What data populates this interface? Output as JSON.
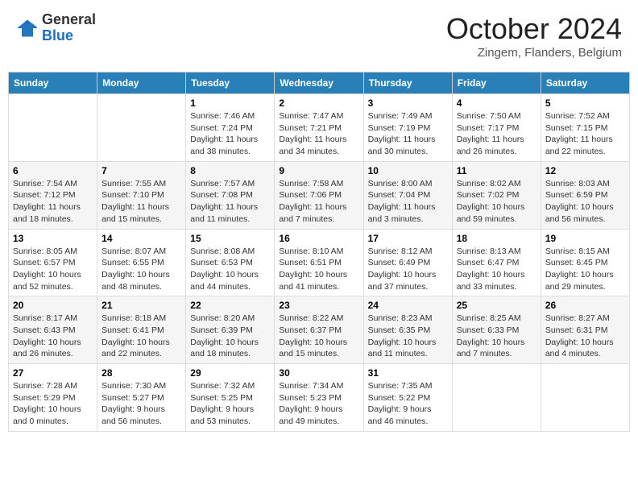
{
  "header": {
    "logo": {
      "general": "General",
      "blue": "Blue"
    },
    "title": "October 2024",
    "location": "Zingem, Flanders, Belgium"
  },
  "days_of_week": [
    "Sunday",
    "Monday",
    "Tuesday",
    "Wednesday",
    "Thursday",
    "Friday",
    "Saturday"
  ],
  "weeks": [
    [
      {
        "day": "",
        "info": ""
      },
      {
        "day": "",
        "info": ""
      },
      {
        "day": "1",
        "info": "Sunrise: 7:46 AM\nSunset: 7:24 PM\nDaylight: 11 hours and 38 minutes."
      },
      {
        "day": "2",
        "info": "Sunrise: 7:47 AM\nSunset: 7:21 PM\nDaylight: 11 hours and 34 minutes."
      },
      {
        "day": "3",
        "info": "Sunrise: 7:49 AM\nSunset: 7:19 PM\nDaylight: 11 hours and 30 minutes."
      },
      {
        "day": "4",
        "info": "Sunrise: 7:50 AM\nSunset: 7:17 PM\nDaylight: 11 hours and 26 minutes."
      },
      {
        "day": "5",
        "info": "Sunrise: 7:52 AM\nSunset: 7:15 PM\nDaylight: 11 hours and 22 minutes."
      }
    ],
    [
      {
        "day": "6",
        "info": "Sunrise: 7:54 AM\nSunset: 7:12 PM\nDaylight: 11 hours and 18 minutes."
      },
      {
        "day": "7",
        "info": "Sunrise: 7:55 AM\nSunset: 7:10 PM\nDaylight: 11 hours and 15 minutes."
      },
      {
        "day": "8",
        "info": "Sunrise: 7:57 AM\nSunset: 7:08 PM\nDaylight: 11 hours and 11 minutes."
      },
      {
        "day": "9",
        "info": "Sunrise: 7:58 AM\nSunset: 7:06 PM\nDaylight: 11 hours and 7 minutes."
      },
      {
        "day": "10",
        "info": "Sunrise: 8:00 AM\nSunset: 7:04 PM\nDaylight: 11 hours and 3 minutes."
      },
      {
        "day": "11",
        "info": "Sunrise: 8:02 AM\nSunset: 7:02 PM\nDaylight: 10 hours and 59 minutes."
      },
      {
        "day": "12",
        "info": "Sunrise: 8:03 AM\nSunset: 6:59 PM\nDaylight: 10 hours and 56 minutes."
      }
    ],
    [
      {
        "day": "13",
        "info": "Sunrise: 8:05 AM\nSunset: 6:57 PM\nDaylight: 10 hours and 52 minutes."
      },
      {
        "day": "14",
        "info": "Sunrise: 8:07 AM\nSunset: 6:55 PM\nDaylight: 10 hours and 48 minutes."
      },
      {
        "day": "15",
        "info": "Sunrise: 8:08 AM\nSunset: 6:53 PM\nDaylight: 10 hours and 44 minutes."
      },
      {
        "day": "16",
        "info": "Sunrise: 8:10 AM\nSunset: 6:51 PM\nDaylight: 10 hours and 41 minutes."
      },
      {
        "day": "17",
        "info": "Sunrise: 8:12 AM\nSunset: 6:49 PM\nDaylight: 10 hours and 37 minutes."
      },
      {
        "day": "18",
        "info": "Sunrise: 8:13 AM\nSunset: 6:47 PM\nDaylight: 10 hours and 33 minutes."
      },
      {
        "day": "19",
        "info": "Sunrise: 8:15 AM\nSunset: 6:45 PM\nDaylight: 10 hours and 29 minutes."
      }
    ],
    [
      {
        "day": "20",
        "info": "Sunrise: 8:17 AM\nSunset: 6:43 PM\nDaylight: 10 hours and 26 minutes."
      },
      {
        "day": "21",
        "info": "Sunrise: 8:18 AM\nSunset: 6:41 PM\nDaylight: 10 hours and 22 minutes."
      },
      {
        "day": "22",
        "info": "Sunrise: 8:20 AM\nSunset: 6:39 PM\nDaylight: 10 hours and 18 minutes."
      },
      {
        "day": "23",
        "info": "Sunrise: 8:22 AM\nSunset: 6:37 PM\nDaylight: 10 hours and 15 minutes."
      },
      {
        "day": "24",
        "info": "Sunrise: 8:23 AM\nSunset: 6:35 PM\nDaylight: 10 hours and 11 minutes."
      },
      {
        "day": "25",
        "info": "Sunrise: 8:25 AM\nSunset: 6:33 PM\nDaylight: 10 hours and 7 minutes."
      },
      {
        "day": "26",
        "info": "Sunrise: 8:27 AM\nSunset: 6:31 PM\nDaylight: 10 hours and 4 minutes."
      }
    ],
    [
      {
        "day": "27",
        "info": "Sunrise: 7:28 AM\nSunset: 5:29 PM\nDaylight: 10 hours and 0 minutes."
      },
      {
        "day": "28",
        "info": "Sunrise: 7:30 AM\nSunset: 5:27 PM\nDaylight: 9 hours and 56 minutes."
      },
      {
        "day": "29",
        "info": "Sunrise: 7:32 AM\nSunset: 5:25 PM\nDaylight: 9 hours and 53 minutes."
      },
      {
        "day": "30",
        "info": "Sunrise: 7:34 AM\nSunset: 5:23 PM\nDaylight: 9 hours and 49 minutes."
      },
      {
        "day": "31",
        "info": "Sunrise: 7:35 AM\nSunset: 5:22 PM\nDaylight: 9 hours and 46 minutes."
      },
      {
        "day": "",
        "info": ""
      },
      {
        "day": "",
        "info": ""
      }
    ]
  ]
}
